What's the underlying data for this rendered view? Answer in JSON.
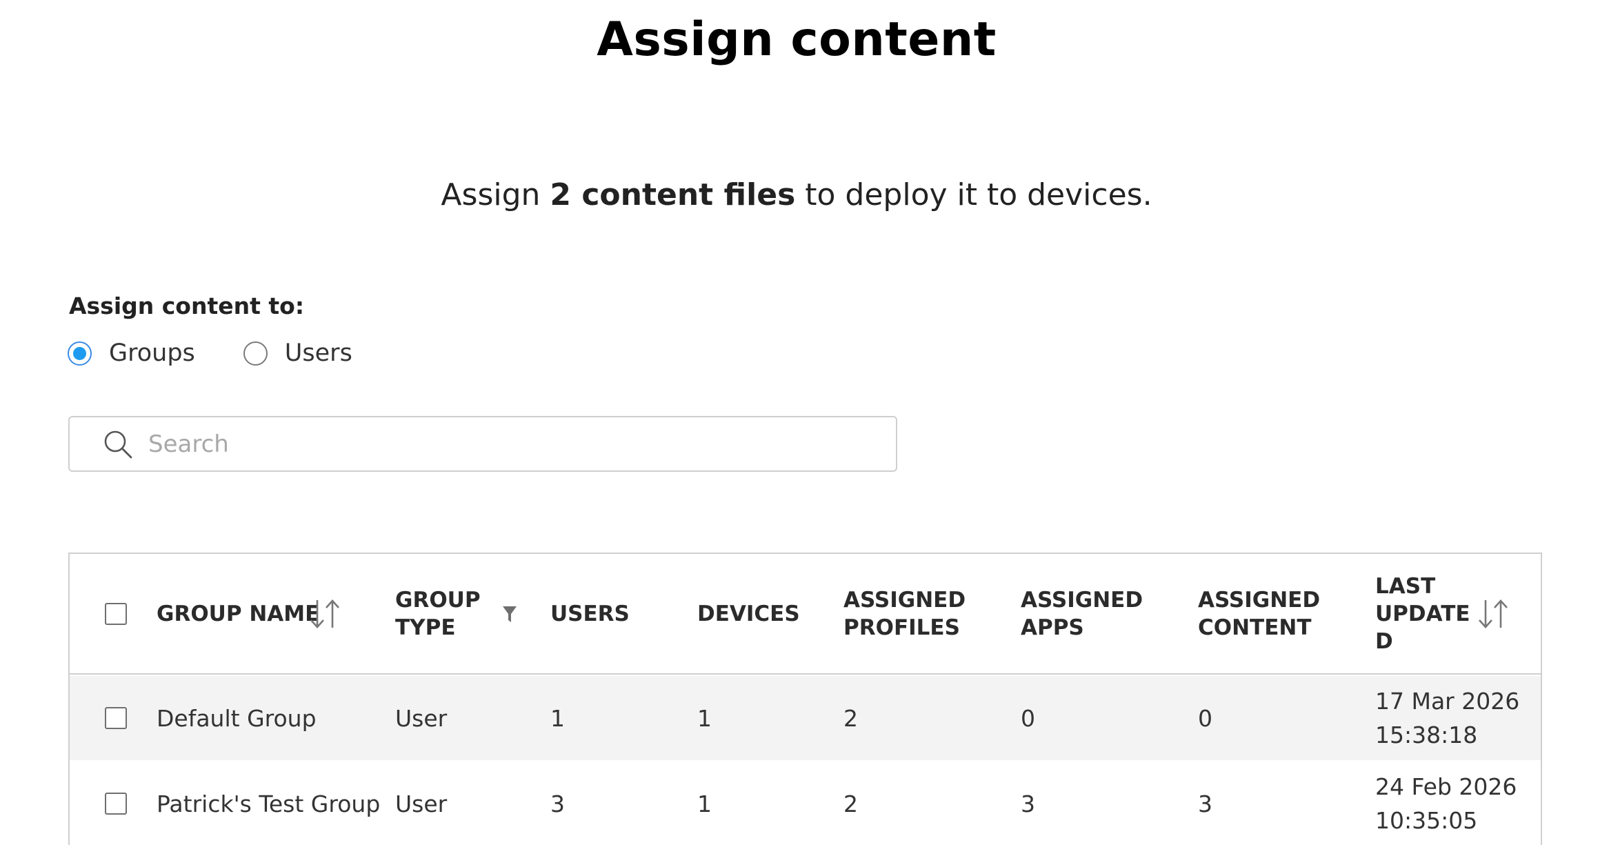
{
  "page": {
    "title": "Assign content",
    "subtitle_prefix": "Assign ",
    "subtitle_bold": "2 content files",
    "subtitle_suffix": " to deploy it to devices."
  },
  "assign": {
    "label": "Assign content to:",
    "options": [
      {
        "label": "Groups",
        "selected": true
      },
      {
        "label": "Users",
        "selected": false
      }
    ]
  },
  "search": {
    "placeholder": "Search",
    "value": "",
    "icon": "search-icon"
  },
  "table": {
    "headers": {
      "group_name": "GROUP NAME",
      "group_type_1": "GROUP",
      "group_type_2": "TYPE",
      "users": "USERS",
      "devices": "DEVICES",
      "profiles_1": "ASSIGNED",
      "profiles_2": "PROFILES",
      "apps_1": "ASSIGNED",
      "apps_2": "APPS",
      "content_1": "ASSIGNED",
      "content_2": "CONTENT",
      "updated_1": "LAST",
      "updated_2": "UPDATE",
      "updated_3": "D"
    },
    "rows": [
      {
        "group_name": "Default Group",
        "group_type": "User",
        "users": "1",
        "devices": "1",
        "assigned_profiles": "2",
        "assigned_apps": "0",
        "assigned_content": "0",
        "last_updated_date": "17 Mar 2026",
        "last_updated_time": "15:38:18"
      },
      {
        "group_name": "Patrick's Test Group",
        "group_type": "User",
        "users": "3",
        "devices": "1",
        "assigned_profiles": "2",
        "assigned_apps": "3",
        "assigned_content": "3",
        "last_updated_date": "24 Feb 2026",
        "last_updated_time": "10:35:05"
      }
    ]
  },
  "colors": {
    "radio_selected": "#1e9bf0",
    "row_highlight": "#f3f3f3",
    "border": "#cfcfcf"
  }
}
